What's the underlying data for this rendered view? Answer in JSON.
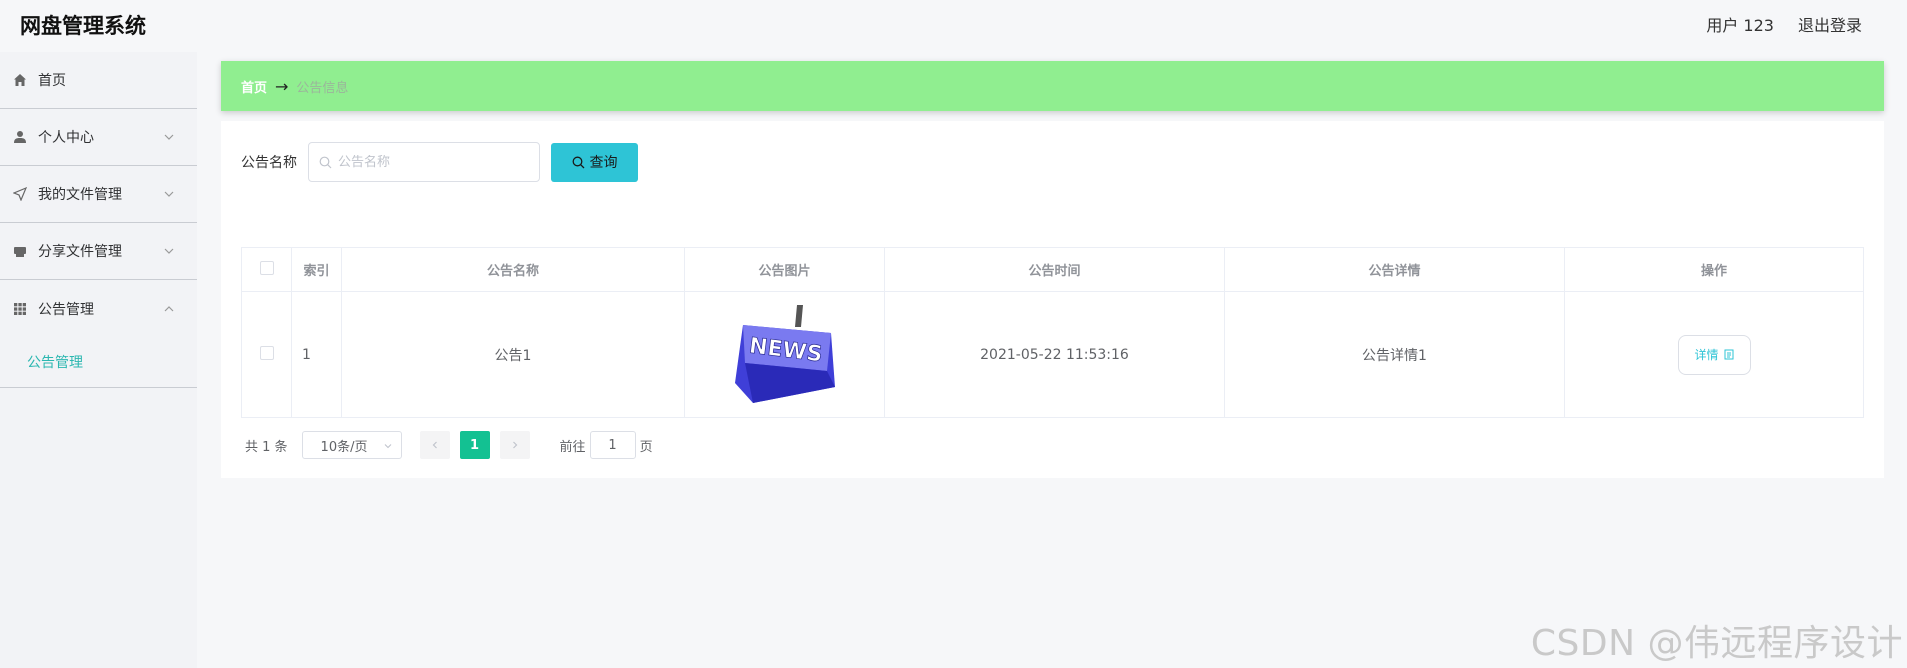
{
  "app": {
    "title": "网盘管理系统",
    "user_label": "用户 123",
    "logout_label": "退出登录"
  },
  "sidebar": {
    "items": [
      {
        "label": "首页",
        "icon": "home-icon"
      },
      {
        "label": "个人中心",
        "icon": "user-icon",
        "expanded": false
      },
      {
        "label": "我的文件管理",
        "icon": "send-icon",
        "expanded": false
      },
      {
        "label": "分享文件管理",
        "icon": "printer-icon",
        "expanded": false
      },
      {
        "label": "公告管理",
        "icon": "grid-icon",
        "expanded": true
      }
    ],
    "submenu_label": "公告管理",
    "accent_color": "#2bb7b0"
  },
  "breadcrumb": {
    "home": "首页",
    "separator": "→",
    "current": "公告信息",
    "bar_color": "#90ee90"
  },
  "search": {
    "label": "公告名称",
    "placeholder": "公告名称",
    "value": "",
    "button_label": "查询",
    "button_color": "#2ec4d6"
  },
  "table": {
    "headers": [
      "索引",
      "公告名称",
      "公告图片",
      "公告时间",
      "公告详情",
      "操作"
    ],
    "rows": [
      {
        "index": "1",
        "name": "公告1",
        "image_text": "NEWS",
        "time": "2021-05-22 11:53:16",
        "detail": "公告详情1",
        "action_label": "详情"
      }
    ]
  },
  "pagination": {
    "total_text": "共 1 条",
    "page_size": "10条/页",
    "current_page": "1",
    "goto_label": "前往",
    "goto_value": "1",
    "page_suffix": "页",
    "active_color": "#13c192"
  },
  "watermark": "CSDN @伟远程序设计"
}
